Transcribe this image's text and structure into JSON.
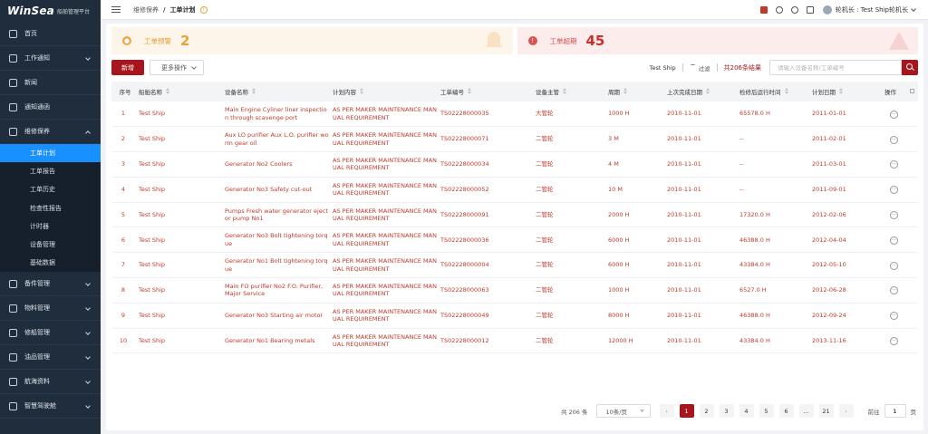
{
  "app": {
    "logo": "WinSea",
    "subtitle": "船舶管理平台"
  },
  "sidebar": {
    "items": [
      {
        "label": "首页",
        "icon": "home-icon",
        "expandable": false
      },
      {
        "label": "工作通知",
        "icon": "notice-icon",
        "expandable": true
      },
      {
        "label": "新闻",
        "icon": "news-icon",
        "expandable": false
      },
      {
        "label": "通知通函",
        "icon": "circular-icon",
        "expandable": false
      },
      {
        "label": "维修保养",
        "icon": "maintenance-icon",
        "expandable": true,
        "expanded": true
      }
    ],
    "submenu": [
      {
        "label": "工单计划",
        "active": true
      },
      {
        "label": "工单报告"
      },
      {
        "label": "工单历史"
      },
      {
        "label": "检查性报告"
      },
      {
        "label": "计时器"
      },
      {
        "label": "设备管理"
      },
      {
        "label": "基础数据"
      }
    ],
    "items_after": [
      {
        "label": "备件管理",
        "icon": "spare-parts-icon"
      },
      {
        "label": "物料管理",
        "icon": "material-icon"
      },
      {
        "label": "修船管理",
        "icon": "repair-icon"
      },
      {
        "label": "油品管理",
        "icon": "oil-icon"
      },
      {
        "label": "航海资料",
        "icon": "nautical-icon"
      },
      {
        "label": "智慧驾驶舱",
        "icon": "dashboard-icon"
      }
    ]
  },
  "topbar": {
    "breadcrumb": [
      "维修保养",
      "工单计划"
    ],
    "user": "轮机长 : Test Ship轮机长"
  },
  "stats": {
    "warning": {
      "label": "工单预警",
      "value": "2"
    },
    "overdue": {
      "label": "工单超期",
      "value": "45"
    }
  },
  "toolbar": {
    "new_label": "新增",
    "more_label": "更多操作",
    "ship": "Test Ship",
    "filter_label": "过滤",
    "result_text": "共206条结果",
    "search_placeholder": "请输入设备名称/工单编号"
  },
  "table": {
    "columns": [
      "序号",
      "船舶名称",
      "设备名称",
      "计划内容",
      "工单编号",
      "设备主管",
      "周期",
      "上次完成日期",
      "检修后运行时间",
      "计划日期",
      "操作"
    ],
    "rows": [
      {
        "idx": "1",
        "ship": "Test Ship",
        "equipment": "Main Engine Cyliner liner inspection through scavenge port",
        "plan": "AS PER MAKER MAINTENANCE MANUAL REQUIREMENT",
        "wo": "TS02228000035",
        "manager": "大管轮",
        "cycle": "1000 H",
        "last": "2010-11-01",
        "runtime": "65578.0 H",
        "planned": "2011-01-01"
      },
      {
        "idx": "2",
        "ship": "Test Ship",
        "equipment": "Aux LO purifier Aux L.O. purifier worm gear oil",
        "plan": "AS PER MAKER MAINTENANCE MANUAL REQUIREMENT",
        "wo": "TS02228000071",
        "manager": "二管轮",
        "cycle": "3 M",
        "last": "2010-11-01",
        "runtime": "--",
        "planned": "2011-02-01"
      },
      {
        "idx": "3",
        "ship": "Test Ship",
        "equipment": "Generator No2 Coolers",
        "plan": "AS PER MAKER MAINTENANCE MANUAL REQUIREMENT",
        "wo": "TS02228000034",
        "manager": "二管轮",
        "cycle": "4 M",
        "last": "2010-11-01",
        "runtime": "--",
        "planned": "2011-03-01"
      },
      {
        "idx": "4",
        "ship": "Test Ship",
        "equipment": "Generator No3 Safety cut-out",
        "plan": "AS PER MAKER MAINTENANCE MANUAL REQUIREMENT",
        "wo": "TS02228000052",
        "manager": "二管轮",
        "cycle": "10 M",
        "last": "2010-11-01",
        "runtime": "--",
        "planned": "2011-09-01"
      },
      {
        "idx": "5",
        "ship": "Test Ship",
        "equipment": "Pumps Fresh water generator ejector pump No1",
        "plan": "AS PER MAKER MAINTENANCE MANUAL REQUIREMENT",
        "wo": "TS02228000091",
        "manager": "二管轮",
        "cycle": "2000 H",
        "last": "2010-11-01",
        "runtime": "17320.0 H",
        "planned": "2012-02-06"
      },
      {
        "idx": "6",
        "ship": "Test Ship",
        "equipment": "Generator No3 Bolt tightening torque",
        "plan": "AS PER MAKER MAINTENANCE MANUAL REQUIREMENT",
        "wo": "TS02228000036",
        "manager": "二管轮",
        "cycle": "6000 H",
        "last": "2010-11-01",
        "runtime": "46388.0 H",
        "planned": "2012-04-04"
      },
      {
        "idx": "7",
        "ship": "Test Ship",
        "equipment": "Generator No1 Bolt tightening torque",
        "plan": "AS PER MAKER MAINTENANCE MANUAL REQUIREMENT",
        "wo": "TS02228000004",
        "manager": "二管轮",
        "cycle": "6000 H",
        "last": "2010-11-01",
        "runtime": "43384.0 H",
        "planned": "2012-05-10"
      },
      {
        "idx": "8",
        "ship": "Test Ship",
        "equipment": "Main FO purifier No2 F.O. Purifier, Major Service",
        "plan": "AS PER MAKER MAINTENANCE MANUAL REQUIREMENT",
        "wo": "TS02228000063",
        "manager": "二管轮",
        "cycle": "1000 H",
        "last": "2010-11-01",
        "runtime": "6527.0 H",
        "planned": "2012-06-28"
      },
      {
        "idx": "9",
        "ship": "Test Ship",
        "equipment": "Generator No3 Starting air motor",
        "plan": "AS PER MAKER MAINTENANCE MANUAL REQUIREMENT",
        "wo": "TS02228000049",
        "manager": "二管轮",
        "cycle": "8000 H",
        "last": "2010-11-01",
        "runtime": "46388.0 H",
        "planned": "2012-09-24"
      },
      {
        "idx": "10",
        "ship": "Test Ship",
        "equipment": "Generator No1 Bearing metals",
        "plan": "AS PER MAKER MAINTENANCE MANUAL REQUIREMENT",
        "wo": "TS02228000012",
        "manager": "二管轮",
        "cycle": "12000 H",
        "last": "2010-11-01",
        "runtime": "43384.0 H",
        "planned": "2013-11-16"
      }
    ]
  },
  "pagination": {
    "total": "共 206 条",
    "page_size": "10条/页",
    "pages": [
      "1",
      "2",
      "3",
      "4",
      "5",
      "6",
      "...",
      "21"
    ],
    "current": "1",
    "goto_label": "前往",
    "goto_value": "1",
    "goto_unit": "页"
  },
  "colors": {
    "accent": "#a8161d",
    "sidebar": "#1f2d3d",
    "active_menu": "#1890ff",
    "warning": "#e5a23b",
    "danger": "#c9302c"
  }
}
